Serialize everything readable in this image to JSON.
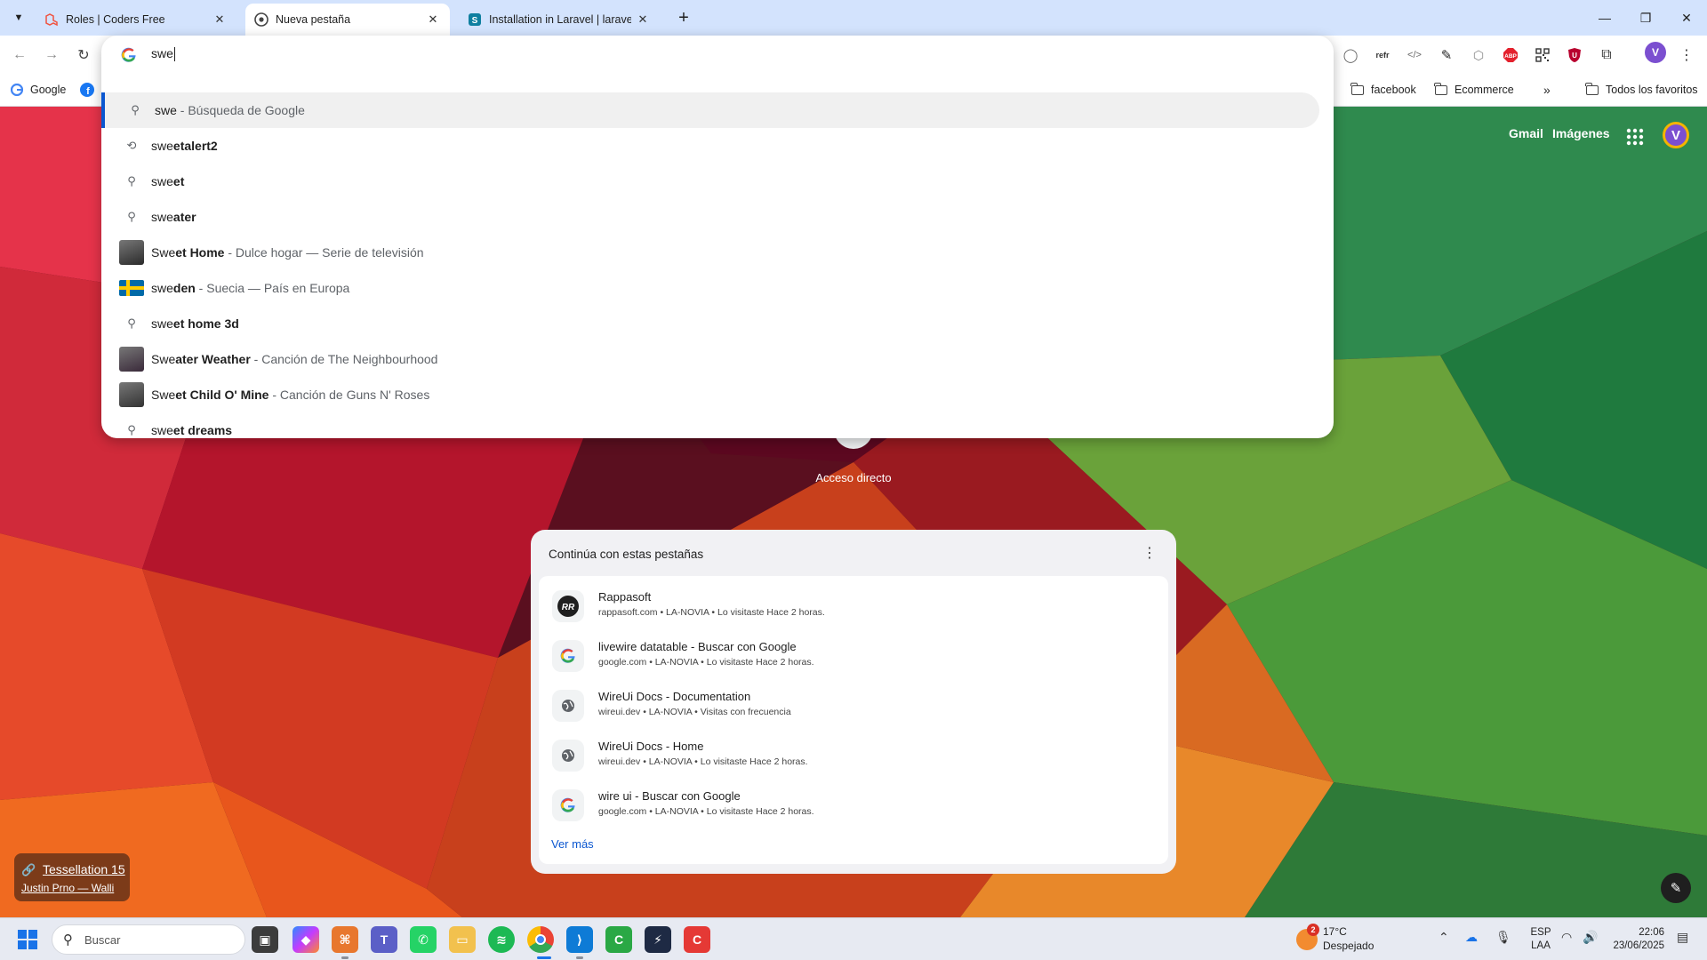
{
  "tabs": [
    {
      "title": "Roles | Coders Free",
      "active": false
    },
    {
      "title": "Nueva pestaña",
      "active": true
    },
    {
      "title": "Installation in Laravel | laravel-s",
      "active": false
    }
  ],
  "omnibox": {
    "query": "swe",
    "suggestions": [
      {
        "icon": "search-icon",
        "typed": "swe",
        "completion": "",
        "desc": " - Búsqueda de Google"
      },
      {
        "icon": "history-icon",
        "typed": "swe",
        "completion": "etalert2",
        "desc": ""
      },
      {
        "icon": "search-icon",
        "typed": "swe",
        "completion": "et",
        "desc": ""
      },
      {
        "icon": "search-icon",
        "typed": "swe",
        "completion": "ater",
        "desc": ""
      },
      {
        "icon": "thumbnail",
        "typed": "Swe",
        "completion": "et Home",
        "desc": " - Dulce hogar — Serie de televisión"
      },
      {
        "icon": "flag-sweden",
        "typed": "swe",
        "completion": "den",
        "desc": " - Suecia — País en Europa"
      },
      {
        "icon": "search-icon",
        "typed": "swe",
        "completion": "et home 3d",
        "desc": ""
      },
      {
        "icon": "thumbnail",
        "typed": "Swe",
        "completion": "ater Weather",
        "desc": " - Canción de The Neighbourhood"
      },
      {
        "icon": "thumbnail",
        "typed": "Swe",
        "completion": "et Child O' Mine",
        "desc": " - Canción de Guns N' Roses"
      },
      {
        "icon": "search-icon",
        "typed": "swe",
        "completion": "et dreams",
        "desc": ""
      }
    ]
  },
  "bookmarks": {
    "google": "Google",
    "facebook": "facebook",
    "ecommerce": "Ecommerce",
    "all": "Todos los favoritos"
  },
  "extensions": {
    "refr": "refr",
    "abp": "ABP"
  },
  "ntp": {
    "gmail": "Gmail",
    "images": "Imágenes",
    "avatar_letter": "V",
    "shortcut_label": "Acceso directo"
  },
  "continue_card": {
    "title": "Continúa con estas pestañas",
    "items": [
      {
        "name": "Rappasoft",
        "meta": "rappasoft.com • LA-NOVIA • Lo visitaste Hace 2 horas.",
        "fav": "rappasoft"
      },
      {
        "name": "livewire datatable - Buscar con Google",
        "meta": "google.com • LA-NOVIA • Lo visitaste Hace 2 horas.",
        "fav": "google"
      },
      {
        "name": "WireUi Docs - Documentation",
        "meta": "wireui.dev • LA-NOVIA • Visitas con frecuencia",
        "fav": "globe"
      },
      {
        "name": "WireUi Docs - Home",
        "meta": "wireui.dev • LA-NOVIA • Lo visitaste Hace 2 horas.",
        "fav": "globe"
      },
      {
        "name": "wire ui - Buscar con Google",
        "meta": "google.com • LA-NOVIA • Lo visitaste Hace 2 horas.",
        "fav": "google"
      }
    ],
    "more": "Ver más"
  },
  "attribution": {
    "title": "Tessellation 15",
    "author": "Justin Prno — Walli"
  },
  "taskbar": {
    "search_placeholder": "Buscar",
    "weather_badge": "2",
    "temperature": "17°C",
    "condition": "Despejado",
    "lang_top": "ESP",
    "lang_bottom": "LAA",
    "time": "22:06",
    "date": "23/06/2025"
  },
  "colors": {
    "accent": "#0b57d0",
    "tabstrip": "#d3e3fd",
    "avatar": "#7b4fd0"
  }
}
